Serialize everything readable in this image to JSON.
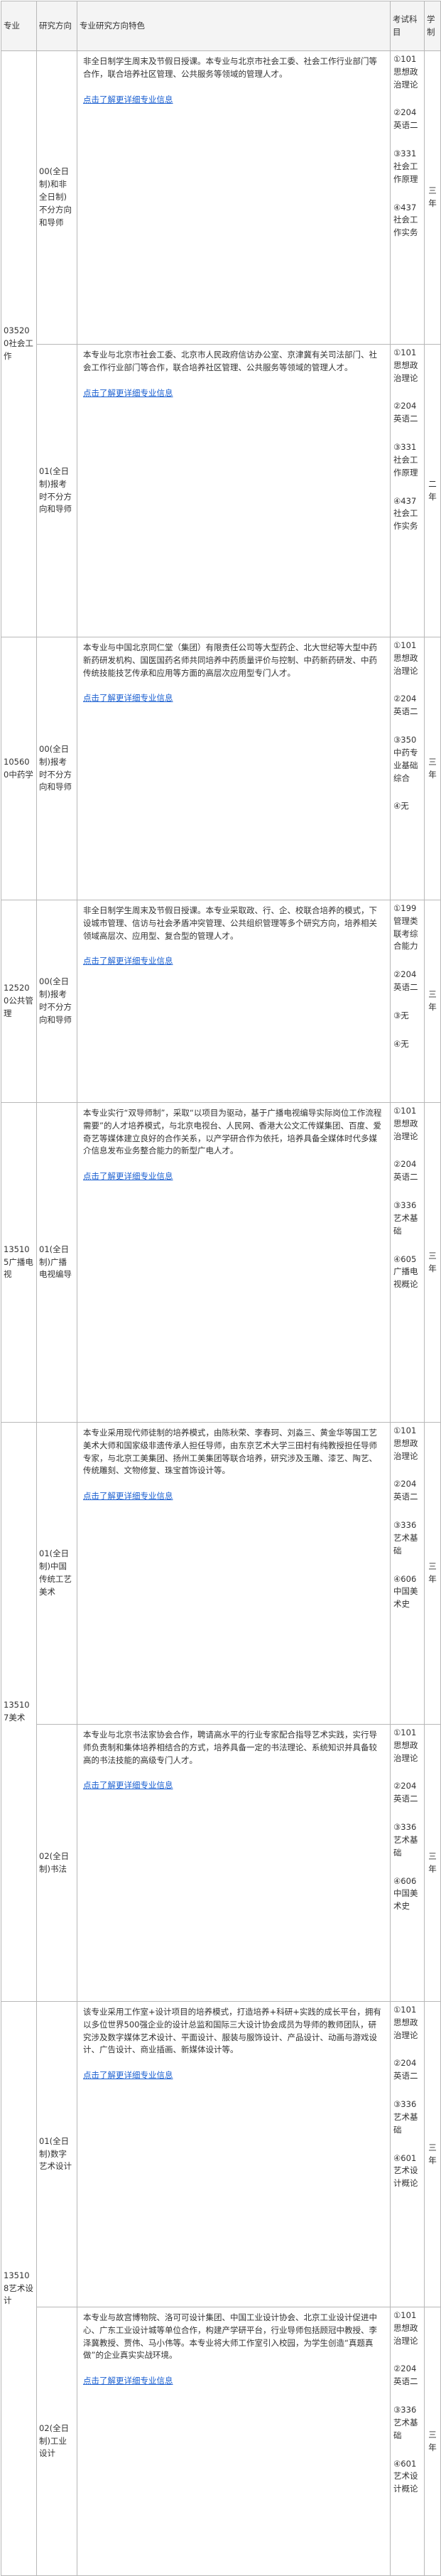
{
  "header": {
    "major": "专业",
    "direction": "研究方向",
    "features": "专业研究方向特色",
    "subjects": "考试科目",
    "duration": "学制"
  },
  "link_text": "点击了解更详细专业信息",
  "rows": [
    {
      "major": "035200社会工作",
      "direction": "00(全日制)和非全日制)不分方向和导师",
      "features": "非全日制学生周末及节假日授课。本专业与北京市社会工委、社会工作行业部门等合作，联合培养社区管理、公共服务等领域的管理人才。",
      "subjects": [
        "①101思想政治理论",
        "②204英语二",
        "③331社会工作原理",
        "④437社会工作实务"
      ],
      "duration": "三年"
    },
    {
      "major": "",
      "direction": "01(全日制)报考时不分方向和导师",
      "features": "本专业与北京市社会工委、北京市人民政府信访办公室、京津冀有关司法部门、社会工作行业部门等合作，联合培养社区管理、公共服务等领域的管理人才。",
      "subjects": [
        "①101思想政治理论",
        "②204英语二",
        "③331社会工作原理",
        "④437社会工作实务"
      ],
      "duration": "二年"
    },
    {
      "major": "105600中药学",
      "direction": "00(全日制)报考时不分方向和导师",
      "features": "本专业与中国北京同仁堂（集团）有限责任公司等大型药企、北大世纪等大型中药新药研发机构、国医国药名师共同培养中药质量评价与控制、中药新药研发、中药传统技能技艺传承和应用等方面的高层次应用型专门人才。",
      "subjects": [
        "①101思想政治理论",
        "②204英语二",
        "③350中药专业基础综合",
        "④无"
      ],
      "duration": "三年"
    },
    {
      "major": "125200公共管理",
      "direction": "00(全日制)报考时不分方向和导师",
      "features": "非全日制学生周末及节假日授课。本专业采取政、行、企、校联合培养的模式，下设城市管理、信访与社会矛盾冲突管理、公共组织管理等多个研究方向，培养相关领域高层次、应用型、复合型的管理人才。",
      "subjects": [
        "①199管理类联考综合能力",
        "②204英语二",
        "③无",
        "④无"
      ],
      "duration": "三年"
    },
    {
      "major": "135105广播电视",
      "direction": "01(全日制)广播电视编导",
      "features": "本专业实行“双导师制”，采取“以项目为驱动，基于广播电视编导实际岗位工作流程需要”的人才培养模式，与北京电视台、人民网、香港大公文汇传媒集团、百度、爱奇艺等媒体建立良好的合作关系，以产学研合作为依托，培养具备全媒体时代多媒介信息发布业务整合能力的新型广电人才。",
      "subjects": [
        "①101思想政治理论",
        "②204英语二",
        "③336艺术基础",
        "④605广播电视概论"
      ],
      "duration": "三年"
    },
    {
      "major": "135107美术",
      "direction": "01(全日制)中国传统工艺美术",
      "features": "本专业采用现代师徒制的培养模式，由陈秋荣、李春珂、刘淼三、黄金华等国工艺美术大师和国家级非遗传承人担任导师，由东京艺术大学三田村有纯教授担任导师专家，与北京工美集团、扬州工美集团等联合培养，研究涉及玉雕、漆艺、陶艺、传统雕刻、文物修复、珠宝首饰设计等。",
      "subjects": [
        "①101思想政治理论",
        "②204英语二",
        "③336艺术基础",
        "④606中国美术史"
      ],
      "duration": "三年"
    },
    {
      "major": "",
      "direction": "02(全日制)书法",
      "features": "本专业与北京书法家协会合作，聘请高水平的行业专家配合指导艺术实践，实行导师负责制和集体培养相结合的方式，培养具备一定的书法理论、系统知识并具备较高的书法技能的高级专门人才。",
      "subjects": [
        "①101思想政治理论",
        "②204英语二",
        "③336艺术基础",
        "④606中国美术史"
      ],
      "duration": "三年"
    },
    {
      "major": "135108艺术设计",
      "direction": "01(全日制)数字艺术设计",
      "features": "该专业采用工作室+设计项目的培养模式，打造培养+科研+实践的成长平台，拥有以多位世界500强企业的设计总监和国际三大设计协会成员为导师的教师团队，研究涉及数字媒体艺术设计、平面设计、服装与服饰设计、产品设计、动画与游戏设计、广告设计、商业插画、新媒体设计等。",
      "subjects": [
        "①101思想政治理论",
        "②204英语二",
        "③336艺术基础",
        "④601艺术设计概论"
      ],
      "duration": "三年"
    },
    {
      "major": "",
      "direction": "02(全日制)工业设计",
      "features": "本专业与故宫博物院、洛可可设计集团、中国工业设计协会、北京工业设计促进中心、广东工业设计城等单位合作，构建产学研平台，行业导师包括顾冠中教授、李泽冀教授、贾伟、马小伟等。本专业将大师工作室引入校园，为学生创造“真题真做”的企业真实实战环境。",
      "subjects": [
        "①101思想政治理论",
        "②204英语二",
        "③336艺术基础",
        "④601艺术设计概论"
      ],
      "duration": "三年"
    }
  ]
}
